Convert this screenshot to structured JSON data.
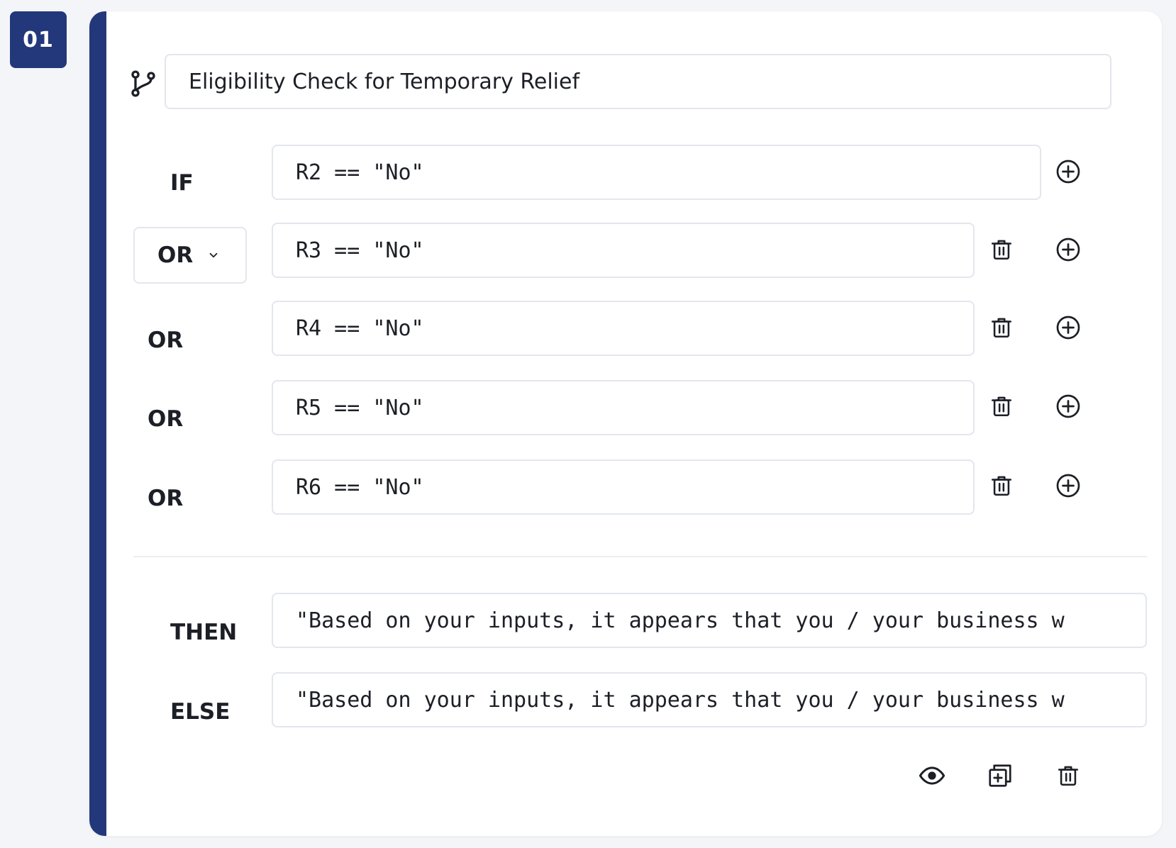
{
  "rule": {
    "number": "01",
    "title": "Eligibility Check for Temporary Relief"
  },
  "conditions": [
    {
      "keyword": "IF",
      "expression": "R2 == \"No\""
    },
    {
      "keyword": "OR",
      "expression": "R3 == \"No\""
    },
    {
      "keyword": "OR",
      "expression": "R4 == \"No\""
    },
    {
      "keyword": "OR",
      "expression": "R5 == \"No\""
    },
    {
      "keyword": "OR",
      "expression": "R6 == \"No\""
    }
  ],
  "then": {
    "keyword": "THEN",
    "value": "\"Based on your inputs, it appears that you / your business w"
  },
  "else": {
    "keyword": "ELSE",
    "value": "\"Based on your inputs, it appears that you / your business w"
  },
  "icons": {
    "branch": "git-branch-icon",
    "add": "plus-circle-icon",
    "delete": "trash-icon",
    "chevron": "chevron-down-icon",
    "preview": "eye-icon",
    "duplicate": "duplicate-icon"
  },
  "colors": {
    "accent": "#22387a",
    "border": "#e3e6ec",
    "background": "#f4f5f8"
  }
}
